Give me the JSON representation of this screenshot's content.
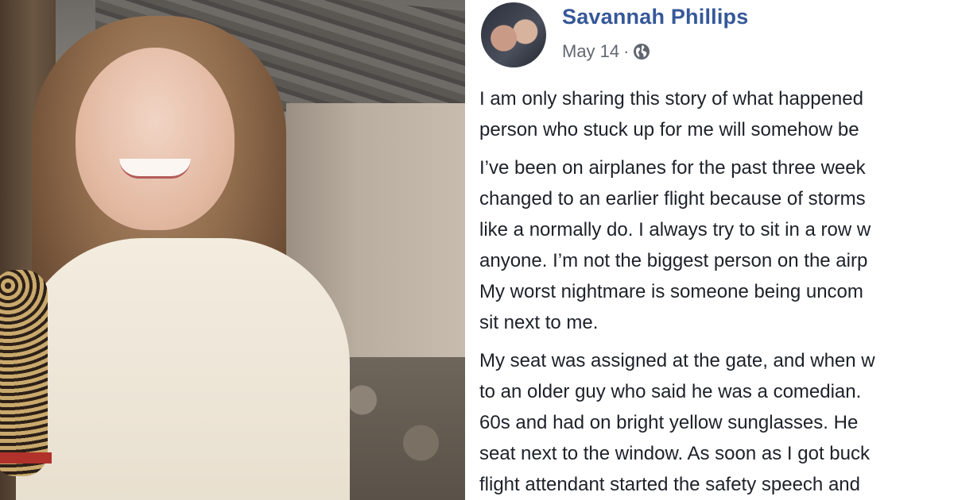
{
  "post": {
    "author": "Savannah Phillips",
    "date": "May 14",
    "separator": "·",
    "privacy_icon": "globe-icon",
    "paragraphs": [
      "I am only sharing this story of what happened\nperson who stuck up for me will somehow be",
      "I’ve been on airplanes for the past three week\nchanged to an earlier flight because of storms\nlike a normally do. I always try to sit in a row w\nanyone. I’m not the biggest person on the airp\nMy worst nightmare is someone being uncom\nsit next to me.",
      "My seat was assigned at the gate, and when w\nto an older guy who said he was a comedian.\n60s and had on bright yellow sunglasses. He\nseat next to the window. As soon as I got buck\nflight attendant started the safety speech and"
    ]
  },
  "colors": {
    "name": "#365899",
    "meta": "#616770",
    "text": "#1d2129"
  }
}
